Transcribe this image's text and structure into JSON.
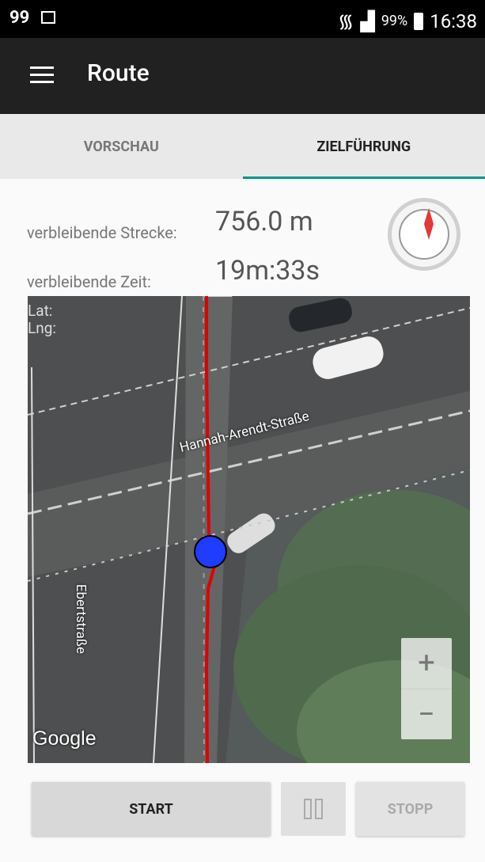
{
  "status_bar": {
    "left_label": "99",
    "battery_percent": "99%",
    "time": "16:38"
  },
  "toolbar": {
    "title": "Route"
  },
  "tabs": [
    {
      "label": "VORSCHAU"
    },
    {
      "label": "ZIELFÜHRUNG"
    }
  ],
  "navigation": {
    "distance_label": "verbleibende Strecke:",
    "distance_value": "756.0 m",
    "time_label": "verbleibende Zeit:",
    "time_value": "19m:33s"
  },
  "map": {
    "lat_label": "Lat:",
    "lng_label": "Lng:",
    "streets": [
      {
        "name": "Hannah-Arendt-Straße"
      },
      {
        "name": "Ebertstraße"
      }
    ],
    "attribution": "Google",
    "zoom_in": "+",
    "zoom_out": "−"
  },
  "controls": {
    "start_label": "START",
    "stop_label": "STOPP"
  },
  "colors": {
    "accent": "#009688",
    "route": "#e00000",
    "location_marker": "#1f3cff"
  }
}
